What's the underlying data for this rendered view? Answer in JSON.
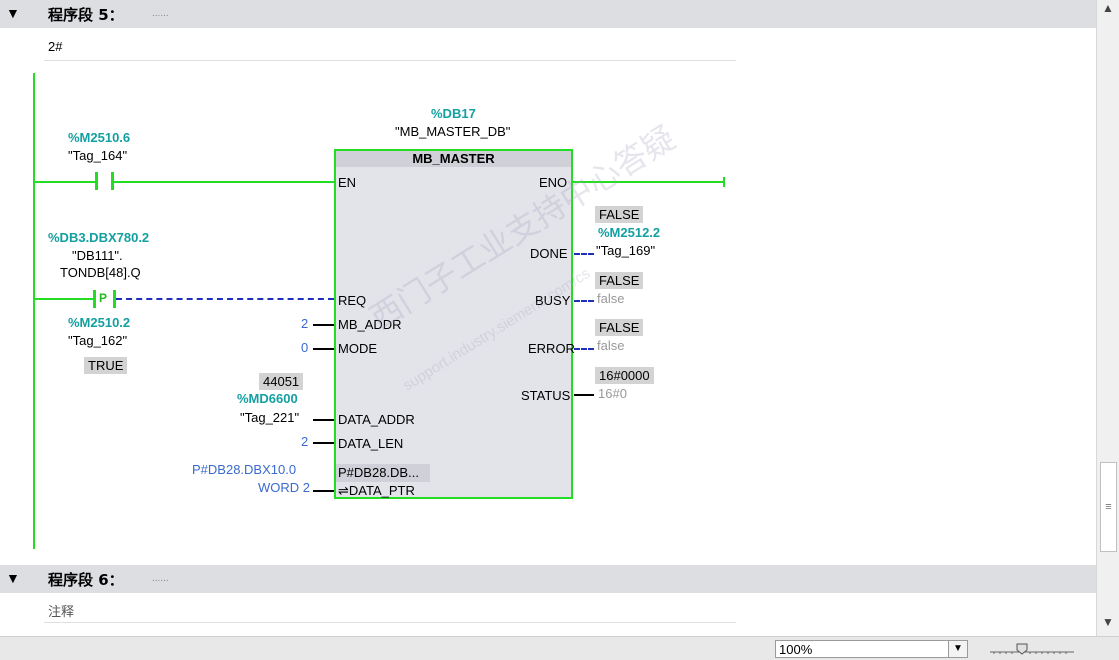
{
  "network5": {
    "title": "程序段 5：",
    "dots": "......",
    "comment": "2#"
  },
  "network6": {
    "title": "程序段 6：",
    "dots": "......",
    "comment": "注释"
  },
  "contact1": {
    "address": "%M2510.6",
    "tag": "\"Tag_164\""
  },
  "contact2": {
    "address": "%DB3.DBX780.2",
    "tag_line1": "\"DB111\".",
    "tag_line2": "TONDB[48].Q",
    "symbol": "P",
    "edge_address": "%M2510.2",
    "edge_tag": "\"Tag_162\"",
    "edge_value": "TRUE"
  },
  "block": {
    "instance_address": "%DB17",
    "instance_name": "\"MB_MASTER_DB\"",
    "type": "MB_MASTER",
    "pins": {
      "en": "EN",
      "eno": "ENO",
      "req": "REQ",
      "mb_addr": "MB_ADDR",
      "mode": "MODE",
      "data_addr": "DATA_ADDR",
      "data_len": "DATA_LEN",
      "data_ptr": "⇌DATA_PTR",
      "done": "DONE",
      "busy": "BUSY",
      "error": "ERROR",
      "status": "STATUS",
      "data_ptr_value": "P#DB28.DB..."
    }
  },
  "inputs": {
    "mb_addr": "2",
    "mode": "0",
    "data_addr_value": "44051",
    "data_addr_address": "%MD6600",
    "data_addr_tag": "\"Tag_221\"",
    "data_len": "2",
    "data_ptr_line1": "P#DB28.DBX10.0",
    "data_ptr_line2": "WORD 2"
  },
  "outputs": {
    "done_value": "FALSE",
    "done_address": "%M2512.2",
    "done_tag": "\"Tag_169\"",
    "busy_value": "FALSE",
    "busy_tag": "false",
    "error_value": "FALSE",
    "error_tag": "false",
    "status_value": "16#0000",
    "status_tag": "16#0"
  },
  "watermark": {
    "line1": "西门子工业支持中心答疑",
    "line2": "support.industry.siemens.com/cs"
  },
  "statusbar": {
    "zoom": "100%"
  },
  "colors": {
    "power": "#22dd22",
    "teal": "#14a0a0",
    "dashed": "#1e2fbf",
    "header": "#dddee2"
  },
  "icons": [
    "collapse-arrow-icon",
    "scroll-up-icon",
    "scroll-down-icon",
    "grip-icon",
    "dropdown-icon",
    "zoom-slider-icon"
  ]
}
